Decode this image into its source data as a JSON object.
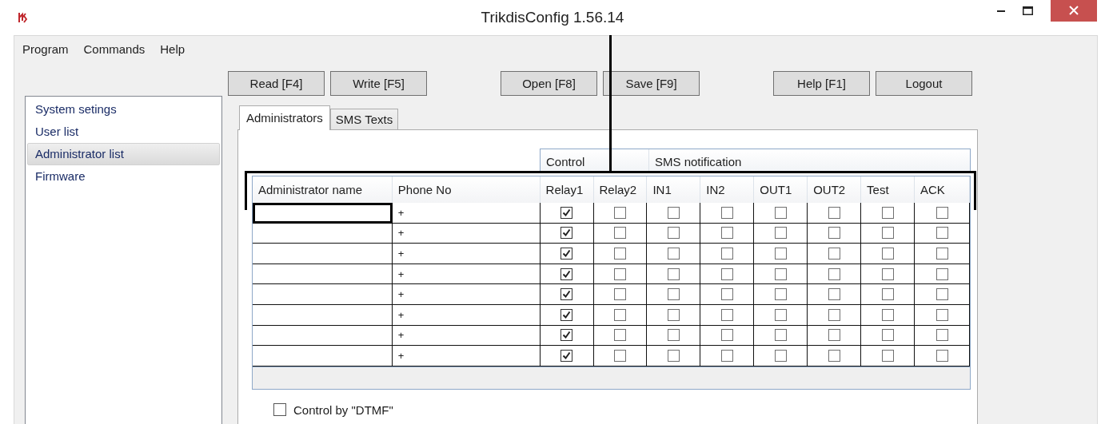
{
  "window": {
    "title": "TrikdisConfig 1.56.14"
  },
  "menu": [
    "Program",
    "Commands",
    "Help"
  ],
  "toolbar": [
    [
      "Read [F4]",
      "Write [F5]"
    ],
    [
      "Open [F8]",
      "Save [F9]"
    ],
    [
      "Help [F1]",
      "Logout"
    ]
  ],
  "sidebar": {
    "items": [
      {
        "label": "System setings",
        "selected": false
      },
      {
        "label": "User list",
        "selected": false
      },
      {
        "label": "Administrator list",
        "selected": true
      },
      {
        "label": "Firmware",
        "selected": false
      }
    ]
  },
  "tabs": [
    {
      "label": "Administrators",
      "selected": true
    },
    {
      "label": "SMS Texts",
      "selected": false
    }
  ],
  "table": {
    "groups": [
      "Control",
      "SMS notification"
    ],
    "columns": [
      "Administrator name",
      "Phone No",
      "Relay1",
      "Relay2",
      "IN1",
      "IN2",
      "OUT1",
      "OUT2",
      "Test",
      "ACK"
    ],
    "rows": [
      {
        "focused": true,
        "phone": "+",
        "flags": [
          true,
          false,
          false,
          false,
          false,
          false,
          false,
          false
        ]
      },
      {
        "focused": false,
        "phone": "+",
        "flags": [
          true,
          false,
          false,
          false,
          false,
          false,
          false,
          false
        ]
      },
      {
        "focused": false,
        "phone": "+",
        "flags": [
          true,
          false,
          false,
          false,
          false,
          false,
          false,
          false
        ]
      },
      {
        "focused": false,
        "phone": "+",
        "flags": [
          true,
          false,
          false,
          false,
          false,
          false,
          false,
          false
        ]
      },
      {
        "focused": false,
        "phone": "+",
        "flags": [
          true,
          false,
          false,
          false,
          false,
          false,
          false,
          false
        ]
      },
      {
        "focused": false,
        "phone": "+",
        "flags": [
          true,
          false,
          false,
          false,
          false,
          false,
          false,
          false
        ]
      },
      {
        "focused": false,
        "phone": "+",
        "flags": [
          true,
          false,
          false,
          false,
          false,
          false,
          false,
          false
        ]
      },
      {
        "focused": false,
        "phone": "+",
        "flags": [
          true,
          false,
          false,
          false,
          false,
          false,
          false,
          false
        ]
      }
    ]
  },
  "dtmf": {
    "label": "Control by \"DTMF\"",
    "checked": false
  }
}
